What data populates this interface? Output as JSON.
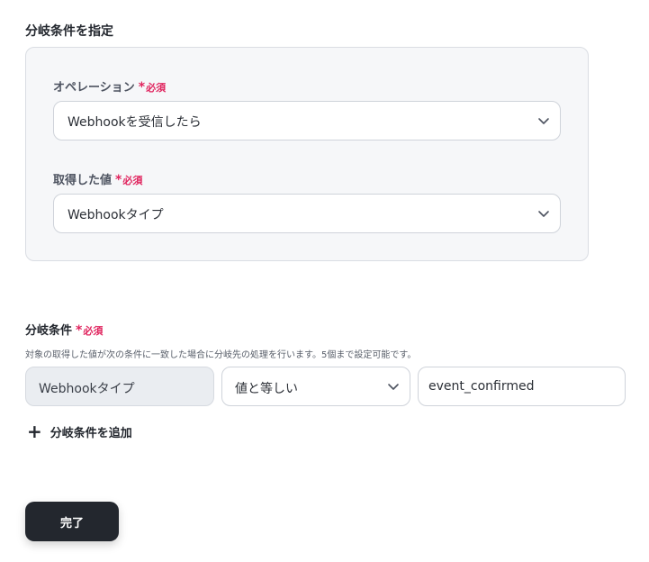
{
  "branch_spec": {
    "title": "分岐条件を指定",
    "operation": {
      "label": "オペレーション",
      "required_mark": "*",
      "required_text": "必須",
      "value": "Webhookを受信したら"
    },
    "acquired_value": {
      "label": "取得した値",
      "required_mark": "*",
      "required_text": "必須",
      "value": "Webhookタイプ"
    }
  },
  "conditions": {
    "title": "分岐条件",
    "required_mark": "*",
    "required_text": "必須",
    "description": "対象の取得した値が次の条件に一致した場合に分岐先の処理を行います。5個まで設定可能です。",
    "rows": [
      {
        "field": "Webhookタイプ",
        "operator": "値と等しい",
        "value": "event_confirmed"
      }
    ],
    "add_label": "分岐条件を追加"
  },
  "footer": {
    "done_label": "完了"
  },
  "colors": {
    "required": "#e0245e",
    "primary_button": "#23272e",
    "panel_bg": "#f6f7f9",
    "readonly_field_bg": "#eaedf1"
  }
}
